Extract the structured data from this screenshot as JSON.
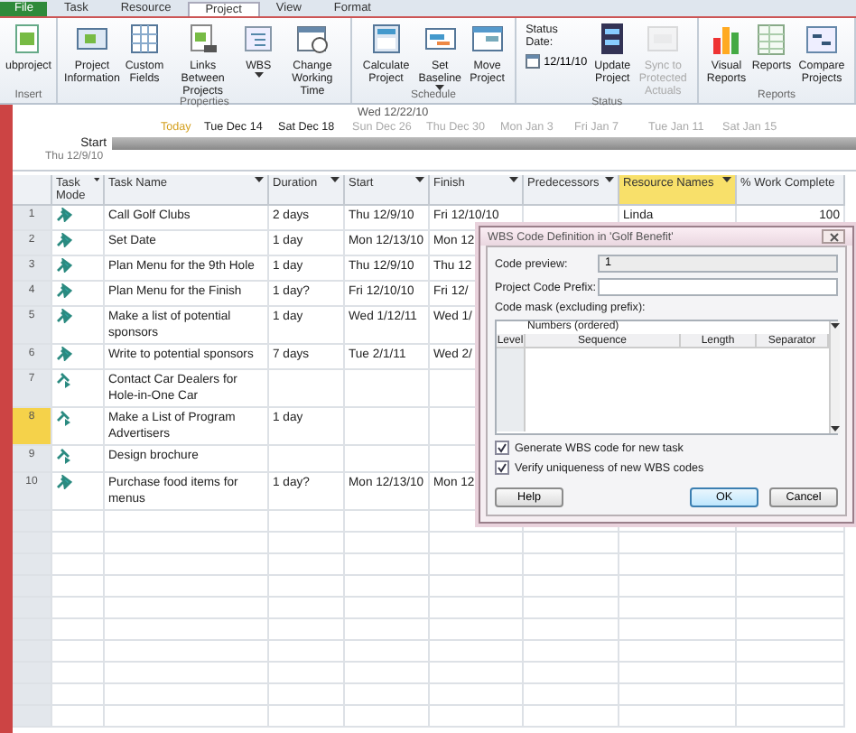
{
  "tabs": [
    {
      "label": "File",
      "kind": "file",
      "selected": false
    },
    {
      "label": "Task",
      "kind": "tab",
      "selected": false
    },
    {
      "label": "Resource",
      "kind": "tab",
      "selected": false
    },
    {
      "label": "Project",
      "kind": "tab",
      "selected": true
    },
    {
      "label": "View",
      "kind": "tab",
      "selected": false
    },
    {
      "label": "Format",
      "kind": "tab",
      "selected": false
    }
  ],
  "ribbon": {
    "groups": [
      {
        "label": "Insert",
        "buttons": [
          {
            "label": "ubproject",
            "kind": "subproject",
            "dropdown": false,
            "disabled": false
          }
        ]
      },
      {
        "label": "Properties",
        "buttons": [
          {
            "label": "Project Information",
            "kind": "info",
            "dropdown": false,
            "disabled": false
          },
          {
            "label": "Custom Fields",
            "kind": "fields",
            "dropdown": false,
            "disabled": false
          },
          {
            "label": "Links Between Projects",
            "kind": "links",
            "dropdown": false,
            "disabled": false
          },
          {
            "label": "WBS",
            "kind": "wbs",
            "dropdown": true,
            "disabled": false
          },
          {
            "label": "Change Working Time",
            "kind": "calendar",
            "dropdown": false,
            "disabled": false
          }
        ]
      },
      {
        "label": "Schedule",
        "buttons": [
          {
            "label": "Calculate Project",
            "kind": "calculate",
            "dropdown": false,
            "disabled": false
          },
          {
            "label": "Set Baseline",
            "kind": "baseline",
            "dropdown": true,
            "disabled": false
          },
          {
            "label": "Move Project",
            "kind": "move",
            "dropdown": false,
            "disabled": false
          }
        ]
      },
      {
        "label": "Status",
        "status_date": {
          "label": "Status Date:",
          "value": "12/11/10"
        },
        "buttons": [
          {
            "label": "Update Project",
            "kind": "update",
            "dropdown": false,
            "disabled": false
          },
          {
            "label": "Sync to Protected Actuals",
            "kind": "sync",
            "dropdown": false,
            "disabled": true
          }
        ]
      },
      {
        "label": "Reports",
        "buttons": [
          {
            "label": "Visual Reports",
            "kind": "chart",
            "dropdown": false,
            "disabled": false
          },
          {
            "label": "Reports",
            "kind": "report",
            "dropdown": false,
            "disabled": false
          },
          {
            "label": "Compare Projects",
            "kind": "compare",
            "dropdown": false,
            "disabled": false
          }
        ]
      }
    ]
  },
  "timeline": {
    "current": "Wed 12/22/10",
    "scale": [
      {
        "label": "Today",
        "kind": "today"
      },
      {
        "label": "Tue Dec 14",
        "kind": "date"
      },
      {
        "label": "Sat Dec 18",
        "kind": "date"
      },
      {
        "label": "Sun Dec 26",
        "kind": "outside"
      },
      {
        "label": "Thu Dec 30",
        "kind": "outside"
      },
      {
        "label": "Mon Jan 3",
        "kind": "outside"
      },
      {
        "label": "Fri Jan 7",
        "kind": "outside"
      },
      {
        "label": "Tue Jan 11",
        "kind": "outside"
      },
      {
        "label": "Sat Jan 15",
        "kind": "outside"
      }
    ],
    "start_label": "Start",
    "start_date": "Thu 12/9/10"
  },
  "table": {
    "columns": [
      {
        "label": "Task Mode",
        "filter": true,
        "selected": false
      },
      {
        "label": "Task Name",
        "filter": true,
        "selected": false
      },
      {
        "label": "Duration",
        "filter": true,
        "selected": false
      },
      {
        "label": "Start",
        "filter": true,
        "selected": false
      },
      {
        "label": "Finish",
        "filter": true,
        "selected": false
      },
      {
        "label": "Predecessors",
        "filter": true,
        "selected": false
      },
      {
        "label": "Resource Names",
        "filter": true,
        "selected": true
      },
      {
        "label": "% Work Complete",
        "filter": false,
        "selected": false
      }
    ],
    "rows": [
      {
        "id": "1",
        "kind": "manual",
        "name": "Call Golf Clubs",
        "duration": "2 days",
        "start": "Thu 12/9/10",
        "finish": "Fri 12/10/10",
        "resource": "Linda",
        "work": "100",
        "selected": false
      },
      {
        "id": "2",
        "kind": "manual",
        "name": "Set Date",
        "duration": "1 day",
        "start": "Mon 12/13/10",
        "finish": "Mon 12",
        "selected": false
      },
      {
        "id": "3",
        "kind": "manual",
        "name": "Plan Menu for the 9th Hole",
        "duration": "1 day",
        "start": "Thu 12/9/10",
        "finish": "Thu 12",
        "selected": false
      },
      {
        "id": "4",
        "kind": "manual",
        "name": "Plan Menu for the Finish",
        "duration": "1 day?",
        "start": "Fri 12/10/10",
        "finish": "Fri 12/",
        "selected": false
      },
      {
        "id": "5",
        "kind": "manual",
        "name": "Make a list of potential sponsors",
        "duration": "1 day",
        "start": "Wed 1/12/11",
        "finish": "Wed 1/",
        "selected": false
      },
      {
        "id": "6",
        "kind": "manual",
        "name": "Write to potential sponsors",
        "duration": "7 days",
        "start": "Tue 2/1/11",
        "finish": "Wed 2/",
        "selected": false
      },
      {
        "id": "7",
        "kind": "auto",
        "name": "Contact Car Dealers for Hole-in-One Car",
        "selected": false
      },
      {
        "id": "8",
        "kind": "auto",
        "name": "Make a List of Program Advertisers",
        "duration": "1 day",
        "selected": true
      },
      {
        "id": "9",
        "kind": "auto",
        "name": "Design brochure",
        "selected": false
      },
      {
        "id": "10",
        "kind": "manual",
        "name": "Purchase food items for menus",
        "duration": "1 day?",
        "start": "Mon 12/13/10",
        "finish": "Mon 12",
        "selected": false
      }
    ]
  },
  "dialog": {
    "title": "WBS Code Definition in 'Golf Benefit'",
    "code_preview": {
      "label": "Code preview:",
      "value": "1"
    },
    "prefix": {
      "label": "Project Code Prefix:"
    },
    "mask_label": "Code mask (excluding prefix):",
    "mask_note": "Numbers (ordered)",
    "mask_columns": [
      "Level",
      "Sequence",
      "Length",
      "Separator"
    ],
    "options": [
      {
        "label": "Generate WBS code for new task",
        "checked": true
      },
      {
        "label": "Verify uniqueness of new WBS codes",
        "checked": true
      }
    ],
    "buttons": [
      {
        "label": "Help",
        "default": false
      },
      {
        "label": "OK",
        "default": true
      },
      {
        "label": "Cancel",
        "default": false
      }
    ]
  }
}
